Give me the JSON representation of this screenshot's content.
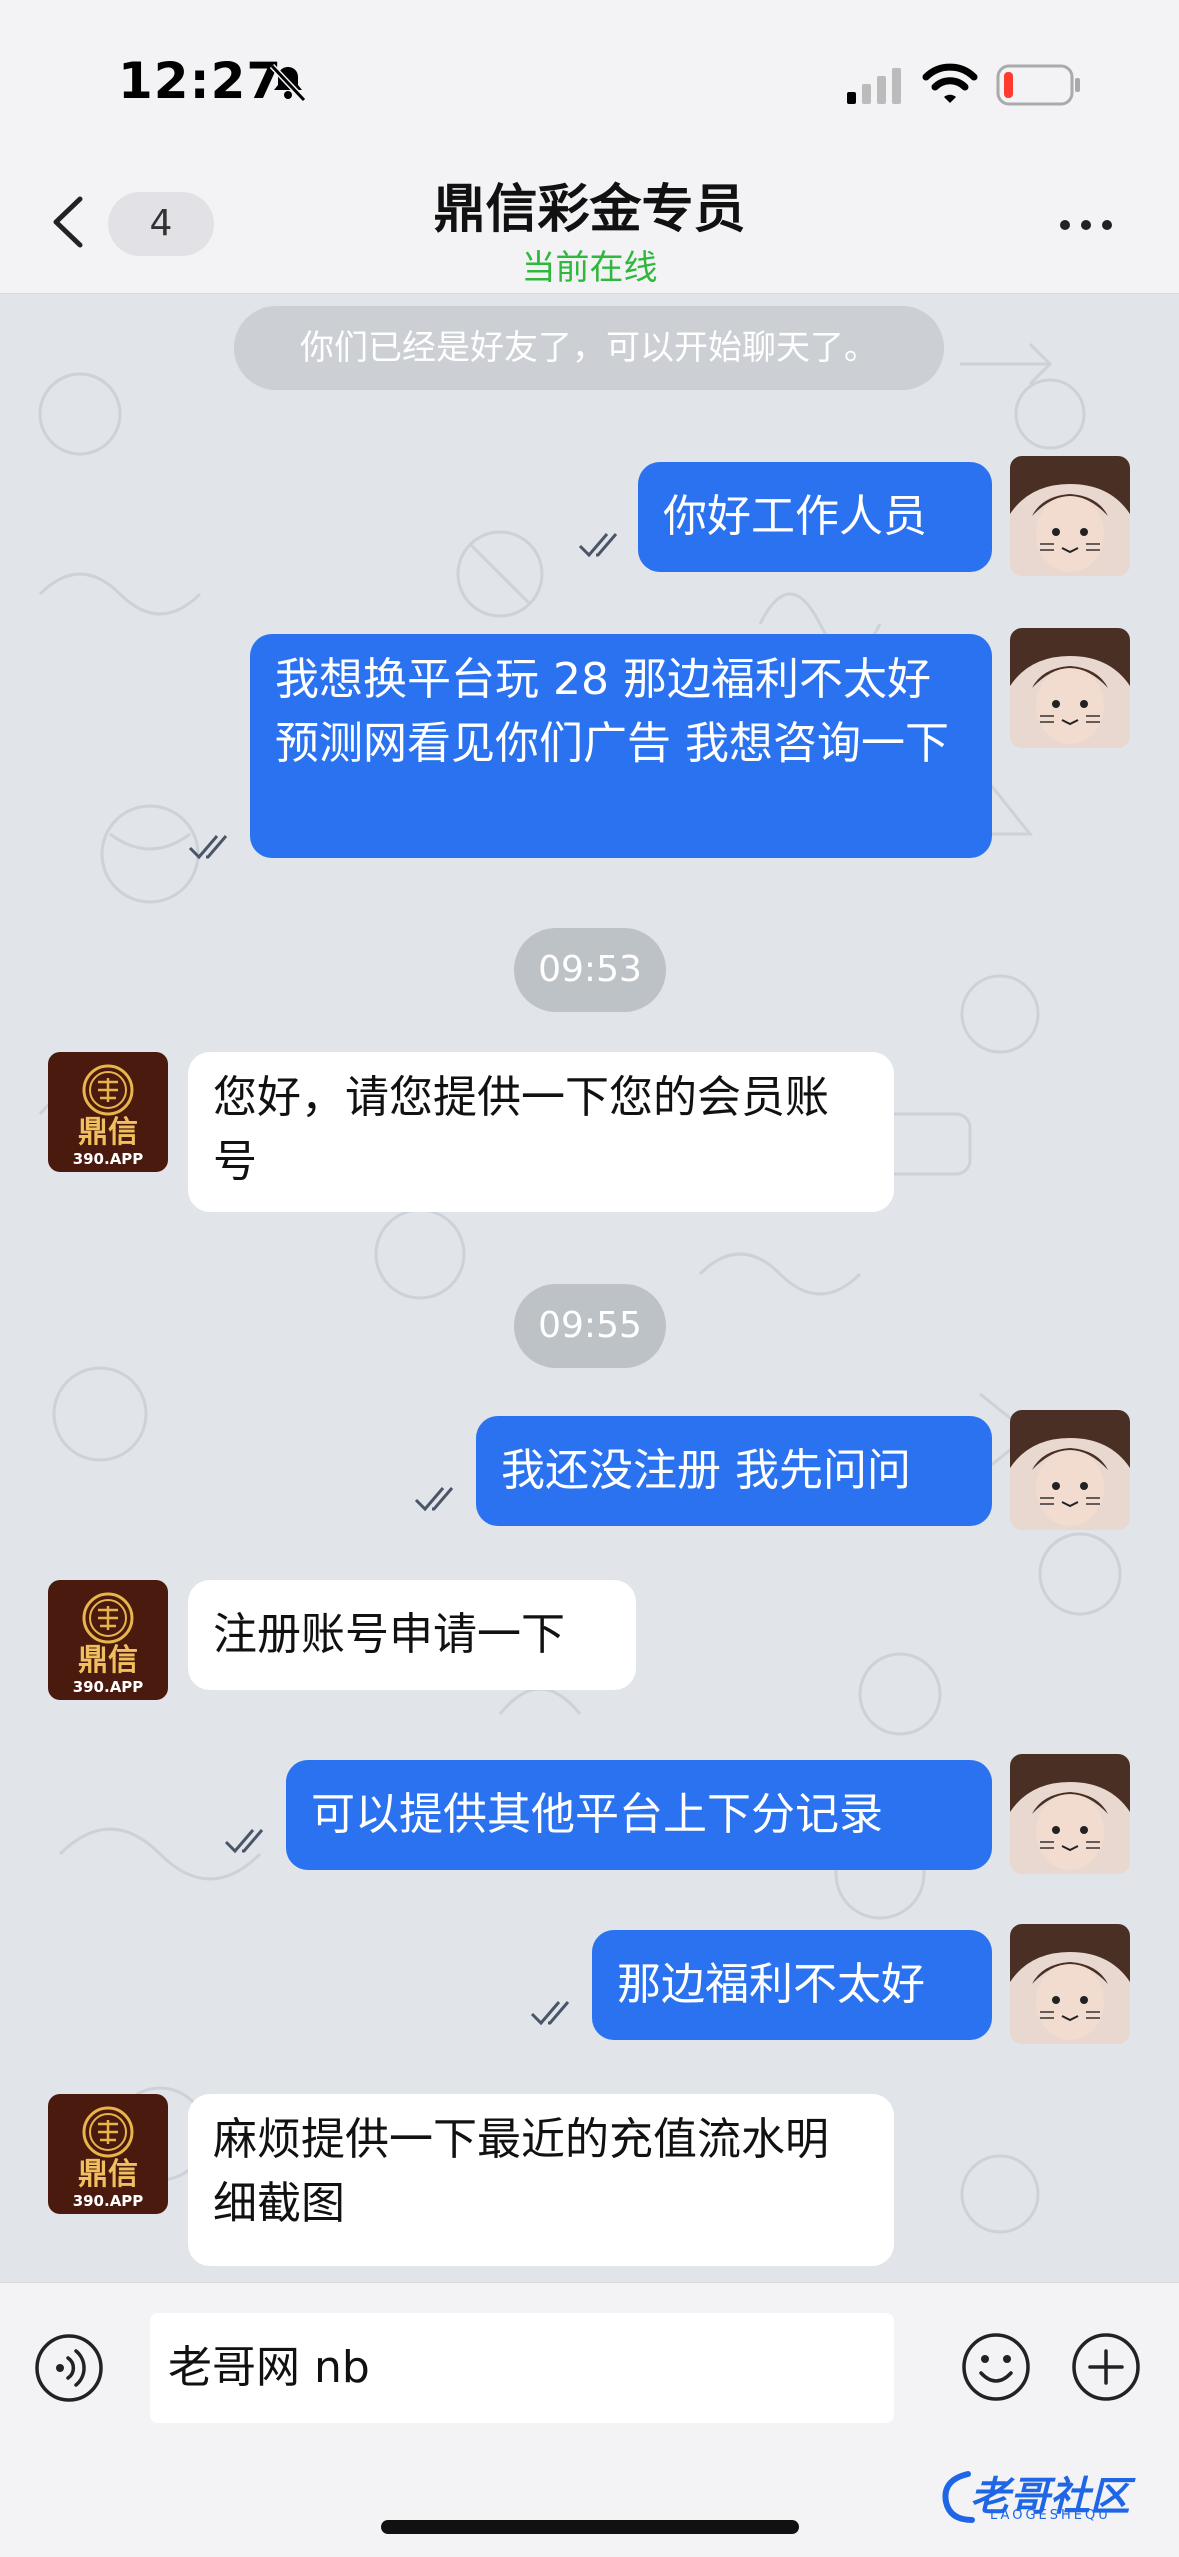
{
  "status_bar": {
    "time": "12:27",
    "battery_level": 0.1
  },
  "header": {
    "unread_count": "4",
    "title": "鼎信彩金专员",
    "subtitle": "当前在线"
  },
  "system_notice": "你们已经是好友了，可以开始聊天了。",
  "messages": [
    {
      "dir": "out",
      "text": "你好工作人员"
    },
    {
      "dir": "out",
      "text": "我想换平台玩 28 那边福利不太好  预测网看见你们广告 我想咨询一下"
    },
    {
      "time": "09:53"
    },
    {
      "dir": "in",
      "text": "您好，请您提供一下您的会员账号"
    },
    {
      "time": "09:55"
    },
    {
      "dir": "out",
      "text": "我还没注册 我先问问"
    },
    {
      "dir": "in",
      "text": "注册账号申请一下"
    },
    {
      "dir": "out",
      "text": "可以提供其他平台上下分记录"
    },
    {
      "dir": "out",
      "text": "那边福利不太好"
    },
    {
      "dir": "in",
      "text": "麻烦提供一下最近的充值流水明细截图"
    }
  ],
  "agent_avatar": {
    "logo_text": "鼎信",
    "caption": "390.APP"
  },
  "input": {
    "value": "老哥网 nb"
  },
  "watermark": {
    "text": "老哥社区",
    "sub": "LAOGESHEQU"
  },
  "colors": {
    "outgoing": "#2a72f0",
    "incoming": "#ffffff",
    "online": "#2fb83d",
    "chat_bg": "#e1e4e9"
  },
  "icons": [
    "bell-slash-icon",
    "signal-icon",
    "wifi-icon",
    "battery-icon",
    "back-chevron-icon",
    "more-icon",
    "read-receipt-icon",
    "voice-icon",
    "emoji-icon",
    "plus-icon"
  ]
}
